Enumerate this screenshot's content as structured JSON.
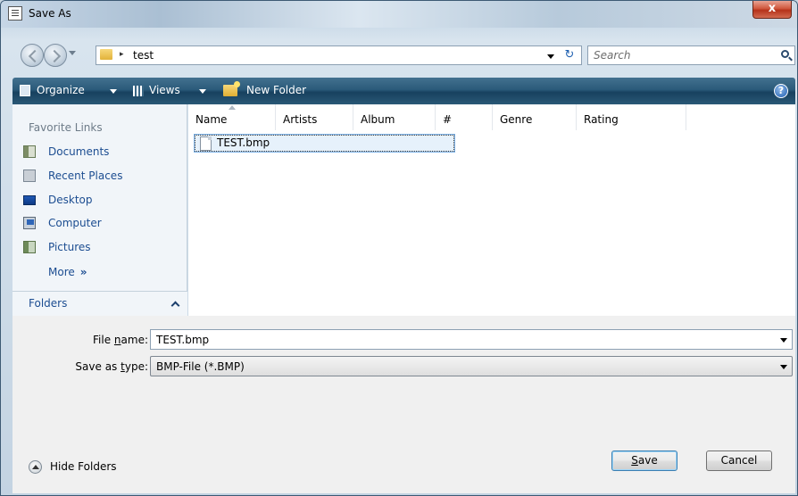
{
  "window": {
    "title": "Save As"
  },
  "title_bar": {
    "close_label": "x"
  },
  "address": {
    "path": "test",
    "separator": "▸"
  },
  "search": {
    "placeholder": "Search"
  },
  "toolbar": {
    "organize_label": "Organize",
    "views_label": "Views",
    "new_folder_label": "New Folder",
    "help_label": "?"
  },
  "favorites": {
    "header": "Favorite Links",
    "items": [
      {
        "label": "Documents",
        "icon": "documents-icon"
      },
      {
        "label": "Recent Places",
        "icon": "recent-places-icon"
      },
      {
        "label": "Desktop",
        "icon": "desktop-icon"
      },
      {
        "label": "Computer",
        "icon": "computer-icon"
      },
      {
        "label": "Pictures",
        "icon": "pictures-icon"
      }
    ],
    "more_label": "More",
    "more_arrow": "»",
    "folders_label": "Folders"
  },
  "file_list": {
    "columns": [
      "Name",
      "Artists",
      "Album",
      "#",
      "Genre",
      "Rating"
    ],
    "files": [
      {
        "name": "TEST.bmp",
        "selected": true
      }
    ]
  },
  "form": {
    "file_name_label_pre": "File ",
    "file_name_label_u": "n",
    "file_name_label_post": "ame:",
    "file_name_value": "TEST.bmp",
    "save_type_label_pre": "Save as ",
    "save_type_label_u": "t",
    "save_type_label_post": "ype:",
    "save_type_value": "BMP-File (*.BMP)"
  },
  "footer": {
    "hide_folders_label": "Hide Folders",
    "save_label_u": "S",
    "save_label_post": "ave",
    "cancel_label": "Cancel"
  }
}
